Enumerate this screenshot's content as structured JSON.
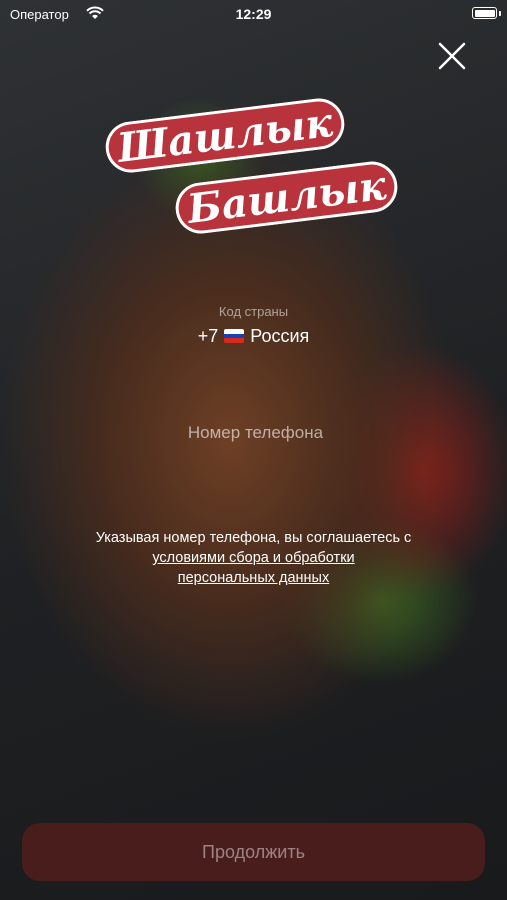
{
  "status_bar": {
    "carrier": "Оператор",
    "time": "12:29",
    "battery_level": 1.0
  },
  "logo": {
    "line1": "Шашлык",
    "line2": "Башлык"
  },
  "country": {
    "label": "Код страны",
    "code": "+7",
    "name": "Россия",
    "flag_colors": [
      "#ffffff",
      "#1c3fb5",
      "#d52b1e"
    ]
  },
  "phone": {
    "placeholder": "Номер телефона",
    "value": ""
  },
  "consent": {
    "text": "Указывая номер телефона, вы соглашаетесь с",
    "link_line1": "условиями сбора и обработки",
    "link_line2": "персональных данных"
  },
  "continue_button": {
    "label": "Продолжить",
    "color": "#4a1d1d"
  },
  "icons": [
    "wifi-icon",
    "battery-icon",
    "close-icon",
    "russia-flag-icon"
  ]
}
